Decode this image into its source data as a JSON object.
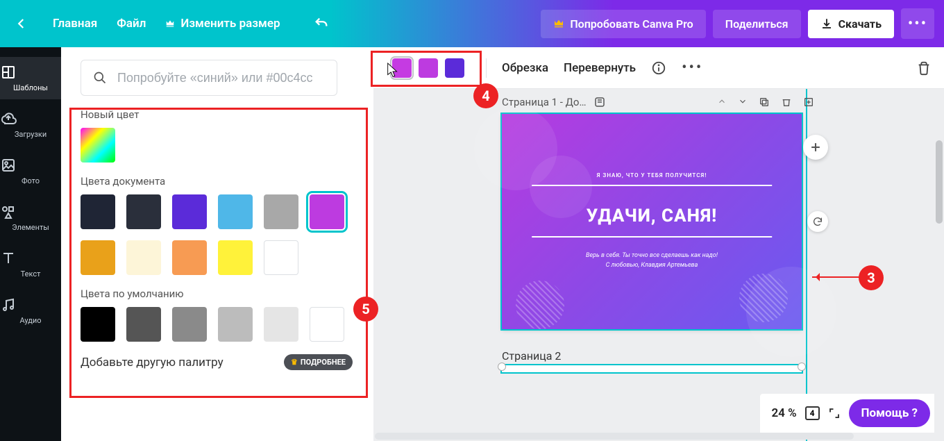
{
  "header": {
    "home": "Главная",
    "file": "Файл",
    "resize": "Изменить размер",
    "try_pro": "Попробовать Canva Pro",
    "share": "Поделиться",
    "download": "Скачать"
  },
  "sidebar": {
    "items": [
      {
        "label": "Шаблоны"
      },
      {
        "label": "Загрузки"
      },
      {
        "label": "Фото"
      },
      {
        "label": "Элементы"
      },
      {
        "label": "Текст"
      },
      {
        "label": "Аудио"
      }
    ]
  },
  "colorpanel": {
    "search_placeholder": "Попробуйте «синий» или #00c4cc",
    "new_color_title": "Новый цвет",
    "doc_colors_title": "Цвета документа",
    "default_colors_title": "Цвета по умолчанию",
    "add_palette": "Добавьте другую палитру",
    "more": "ПОДРОБНЕЕ",
    "doc_colors": [
      "#1f2535",
      "#2a2f3b",
      "#5b2bd9",
      "#4fb7e8",
      "#a8a8a8",
      "#bd3be0",
      "#e9a11a",
      "#fdf5d8",
      "#f79b53",
      "#fff23a",
      "#ffffff"
    ],
    "default_colors": [
      "#000000",
      "#555555",
      "#8a8a8a",
      "#bcbcbc",
      "#e5e5e5",
      "#ffffff"
    ]
  },
  "toolbar2": {
    "crop": "Обрезка",
    "flip": "Перевернуть",
    "gradient_swatches": [
      "#c53be2",
      "#bd3be0",
      "#5b2bd9"
    ]
  },
  "page": {
    "title": "Страница 1 - До…",
    "text_small": "Я ЗНАЮ, ЧТО У ТЕБЯ ПОЛУЧИТСЯ!",
    "text_big": "УДАЧИ, САНЯ!",
    "text_sub1": "Верь в себя. Ты точно все сделаешь как надо!",
    "text_sub2": "С любовью, Клавдия Артемьева",
    "page2_title": "Страница 2"
  },
  "status": {
    "zoom": "24 %",
    "page_count": "4",
    "help": "Помощь  ?"
  },
  "annotations": {
    "n3": "3",
    "n4": "4",
    "n5": "5"
  }
}
